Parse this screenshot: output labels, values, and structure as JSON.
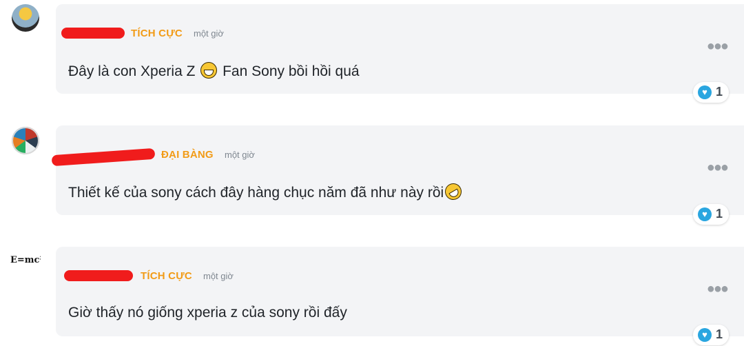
{
  "comments": [
    {
      "role": "TÍCH CỰC",
      "time": "một giờ",
      "text": "Đây là con Xperia Z",
      "text_after_emoji": " Fan Sony bồi hồi quá",
      "emoji": "grinning-face-icon",
      "reactions": "1",
      "avatar_text": ""
    },
    {
      "role": "ĐẠI BÀNG",
      "time": "một giờ",
      "text": "Thiết kế của sony cách đây hàng chục năm đã như này rồi",
      "text_after_emoji": "",
      "emoji": "rolling-on-floor-laughing-icon",
      "reactions": "1",
      "avatar_text": ""
    },
    {
      "role": "TÍCH CỰC",
      "time": "một giờ",
      "text": "Giờ thấy nó giống xperia z của sony rồi đấy",
      "text_after_emoji": "",
      "emoji": "",
      "reactions": "1",
      "avatar_text": "E=mc²"
    }
  ],
  "colors": {
    "card_bg": "#f3f4f6",
    "role": "#f29b16",
    "redaction": "#f01c1c",
    "reaction_heart": "#2aa6e0"
  },
  "icons": {
    "more": "more-dots-icon",
    "reaction": "heart-icon"
  }
}
